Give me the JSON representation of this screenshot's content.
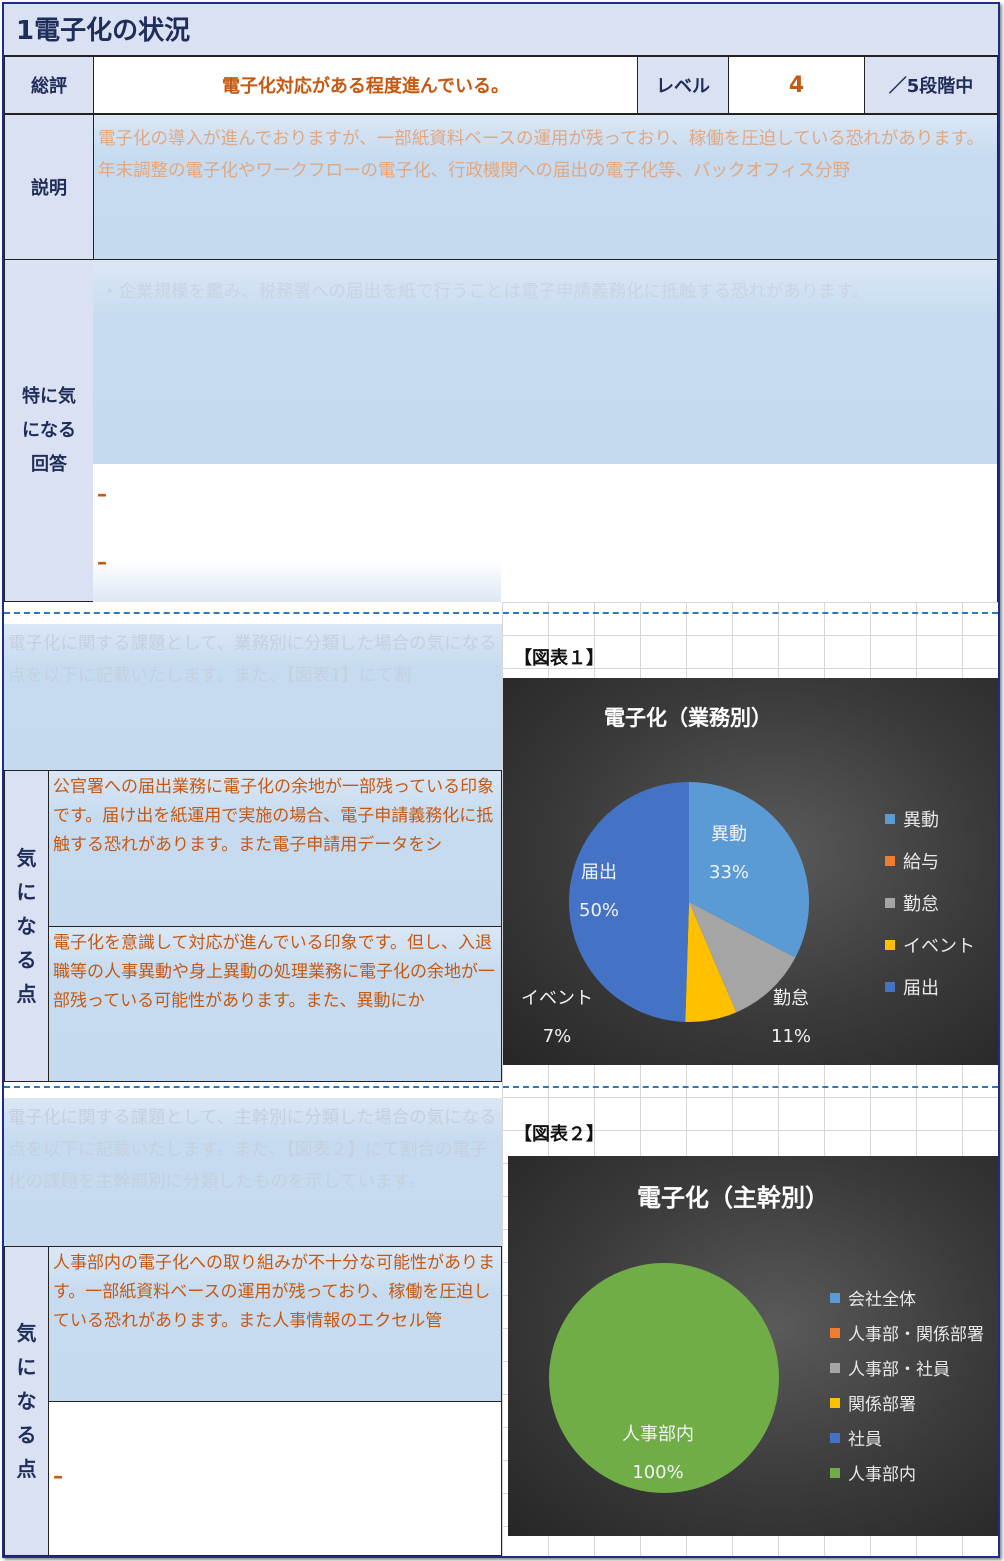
{
  "section_title": "1電子化の状況",
  "summary": {
    "label": "総評",
    "value": "電子化対応がある程度進んでいる。",
    "level_label": "レベル",
    "level_value": "4",
    "level_suffix": "／5段階中"
  },
  "explanation": {
    "label": "説明",
    "text": "電子化の導入が進んでおりますが、一部紙資料ベースの運用が残っており、稼働を圧迫している恐れがあります。年末調整の電子化やワークフローの電子化、行政機関への届出の電子化等、バックオフィス分野"
  },
  "notable_answers": {
    "label": "特に気になる回答",
    "label_lines": [
      "特に気",
      "になる",
      "回答"
    ],
    "text": "・企業規模を鑑み、税務署への届出を紙で行うことは電子申請義務化に抵触する恐れがあります。",
    "row2": "–",
    "row3": "–"
  },
  "business_section": {
    "intro": "電子化に関する課題として、業務別に分類した場合の気になる点を以下に記載いたします。また、【図表1】にて割",
    "side_label": [
      "気",
      "に",
      "な",
      "る",
      "点"
    ],
    "point1": "公官署への届出業務に電子化の余地が一部残っている印象です。届け出を紙運用で実施の場合、電子申請義務化に抵触する恐れがあります。また電子申請用データをシ",
    "point2": "電子化を意識して対応が進んでいる印象です。但し、入退職等の人事異動や身上異動の処理業務に電子化の余地が一部残っている可能性があります。また、異動にか"
  },
  "owner_section": {
    "intro": "電子化に関する課題として、主幹別に分類した場合の気になる点を以下に記載いたします。また、【図表２】にて割合の電子化の課題を主幹部別に分類したものを示しています。",
    "side_label": [
      "気",
      "に",
      "な",
      "る",
      "点"
    ],
    "point1": "人事部内の電子化への取り組みが不十分な可能性があります。一部紙資料ベースの運用が残っており、稼働を圧迫している恐れがあります。また人事情報のエクセル管",
    "point2": "–"
  },
  "figure1_label": "【図表１】",
  "figure2_label": "【図表２】",
  "colors": {
    "blue_light": "#5b9bd5",
    "orange": "#ed7d31",
    "gray": "#a5a5a5",
    "yellow": "#ffc000",
    "blue_dark": "#4472c4",
    "green": "#70ad47"
  },
  "chart_data": [
    {
      "type": "pie",
      "title": "電子化（業務別）",
      "categories": [
        "異動",
        "給与",
        "勤怠",
        "イベント",
        "届出"
      ],
      "values": [
        33,
        0,
        11,
        7,
        50
      ],
      "data_labels": [
        "33%",
        "",
        "11%",
        "7%",
        "50%"
      ],
      "legend": "right"
    },
    {
      "type": "pie",
      "title": "電子化（主幹別）",
      "categories": [
        "会社全体",
        "人事部・関係部署",
        "人事部・社員",
        "関係部署",
        "社員",
        "人事部内"
      ],
      "values": [
        0,
        0,
        0,
        0,
        0,
        100
      ],
      "data_labels": [
        "",
        "",
        "",
        "",
        "",
        "100%"
      ],
      "legend": "right"
    }
  ]
}
